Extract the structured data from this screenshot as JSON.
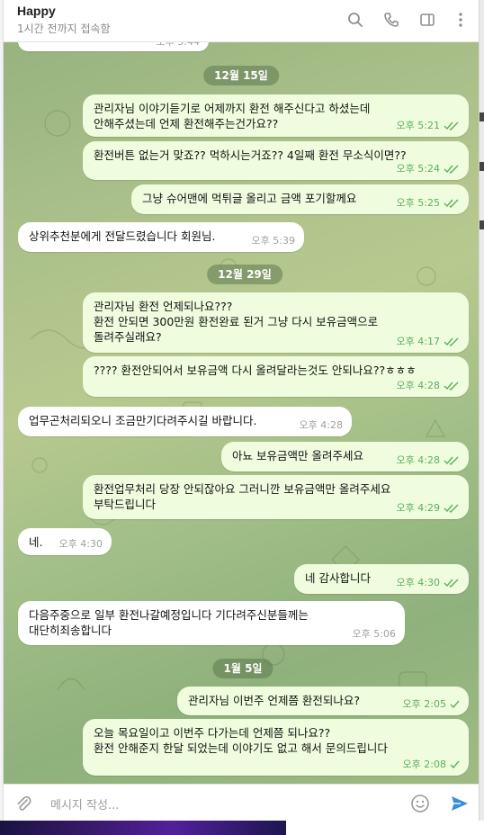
{
  "header": {
    "name": "Happy",
    "status": "1시간 전까지 접속함"
  },
  "composer": {
    "placeholder": "메시지 작성..."
  },
  "partial_top": {
    "time": "오후 5:44"
  },
  "dates": [
    "12월 15일",
    "12월 29일",
    "1월 5일"
  ],
  "messages": [
    {
      "dir": "out",
      "text": "관리자님 이야기듣기로 어제까지 환전 해주신다고 하셨는데\n안해주셨는데 언제 환전해주는건가요??",
      "time": "오후 5:21"
    },
    {
      "dir": "out",
      "text": "환전버튼 없는거 맞죠?? 먹하시는거죠?? 4일째 환전 무소식이면??",
      "time": "오후 5:24"
    },
    {
      "dir": "out",
      "text": "그냥 슈어맨에 먹튀글 올리고 금액 포기할께요",
      "time": "오후 5:25"
    },
    {
      "dir": "in",
      "text": "상위추천분에게 전달드렸습니다 회원님.",
      "time": "오후 5:39"
    },
    {
      "dir": "out",
      "text": "관리자님 환전 언제되나요???\n환전 안되면 300만원 환전완료 된거 그냥 다시 보유금액으로\n돌려주실래요?",
      "time": "오후 4:17"
    },
    {
      "dir": "out",
      "text": "???? 환전안되어서 보유금액 다시 올려달라는것도 안되나요??ㅎㅎㅎ",
      "time": "오후 4:28"
    },
    {
      "dir": "in",
      "text": "업무곤처리되오니 조금만기다려주시길 바랍니다.",
      "time": "오후 4:28"
    },
    {
      "dir": "out",
      "text": "아뇨 보유금액만 올려주세요",
      "time": "오후 4:28"
    },
    {
      "dir": "out",
      "text": "환전업무처리 당장 안되잖아요 그러니깐 보유금액만 올려주세요\n부탁드립니다",
      "time": "오후 4:29"
    },
    {
      "dir": "in",
      "text": "네.",
      "time": "오후 4:30"
    },
    {
      "dir": "out",
      "text": "네 감사합니다",
      "time": "오후 4:30"
    },
    {
      "dir": "in",
      "text": "다음주중으로 일부 환전나갈예정입니다 기다려주신분들께는\n대단히죄송합니다",
      "time": "오후 5:06"
    },
    {
      "dir": "out",
      "text": "관리자님 이번주 언제쯤 환전되나요?",
      "time": "오후 2:05"
    },
    {
      "dir": "out",
      "text": "오늘 목요일이고 이번주 다가는데 언제쯤 되나요??\n환전 안해준지 한달 되었는데 이야기도 없고 해서 문의드립니다",
      "time": "오후 2:08"
    }
  ],
  "colors": {
    "outgoing_bubble": "#effdde",
    "incoming_bubble": "#ffffff",
    "check_green": "#5fae5c",
    "send_blue": "#3a8fd9"
  }
}
